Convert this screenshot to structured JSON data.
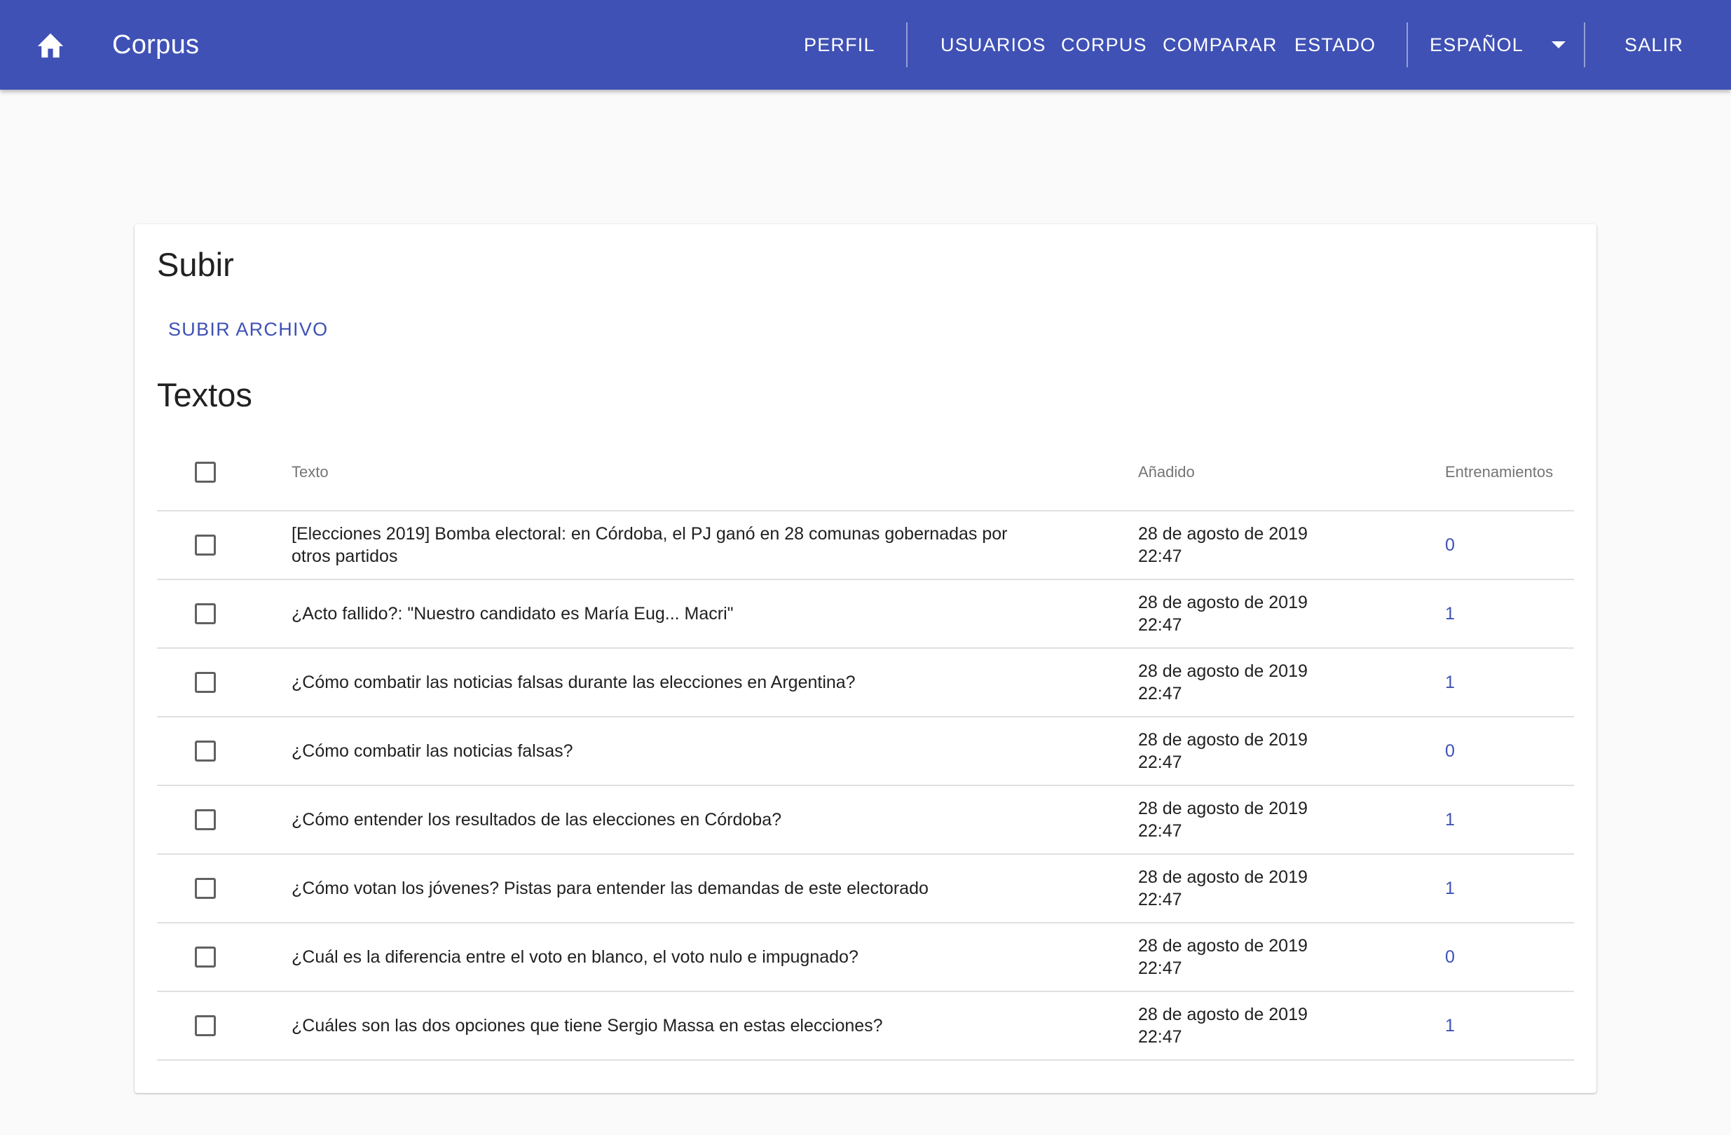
{
  "appbar": {
    "title": "Corpus",
    "nav": {
      "perfil": "PERFIL",
      "usuarios": "USUARIOS",
      "corpus": "CORPUS",
      "comparar": "COMPARAR",
      "estado": "ESTADO",
      "language": "ESPAÑOL",
      "salir": "SALIR"
    },
    "color": "#3f51b5"
  },
  "upload": {
    "title": "Subir",
    "button_label": "SUBIR ARCHIVO"
  },
  "texts": {
    "title": "Textos",
    "columns": {
      "text": "Texto",
      "added": "Añadido",
      "trainings": "Entrenamientos"
    },
    "rows": [
      {
        "text": "[Elecciones 2019] Bomba electoral: en Córdoba, el PJ ganó en 28 comunas gobernadas por otros partidos",
        "date": "28 de agosto de 2019",
        "time": "22:47",
        "trainings": "0"
      },
      {
        "text": "¿Acto fallido?: \"Nuestro candidato es María Eug... Macri\"",
        "date": "28 de agosto de 2019",
        "time": "22:47",
        "trainings": "1"
      },
      {
        "text": "¿Cómo combatir las noticias falsas durante las elecciones en Argentina?",
        "date": "28 de agosto de 2019",
        "time": "22:47",
        "trainings": "1"
      },
      {
        "text": "¿Cómo combatir las noticias falsas?",
        "date": "28 de agosto de 2019",
        "time": "22:47",
        "trainings": "0"
      },
      {
        "text": "¿Cómo entender los resultados de las elecciones en Córdoba?",
        "date": "28 de agosto de 2019",
        "time": "22:47",
        "trainings": "1"
      },
      {
        "text": "¿Cómo votan los jóvenes? Pistas para entender las demandas de este electorado",
        "date": "28 de agosto de 2019",
        "time": "22:47",
        "trainings": "1"
      },
      {
        "text": "¿Cuál es la diferencia entre el voto en blanco, el voto nulo e impugnado?",
        "date": "28 de agosto de 2019",
        "time": "22:47",
        "trainings": "0"
      },
      {
        "text": "¿Cuáles son las dos opciones que tiene Sergio Massa en estas elecciones?",
        "date": "28 de agosto de 2019",
        "time": "22:47",
        "trainings": "1"
      }
    ]
  },
  "icons": {
    "home": "home-icon",
    "dropdown": "caret-down-icon",
    "checkbox": "checkbox-unchecked-icon"
  }
}
